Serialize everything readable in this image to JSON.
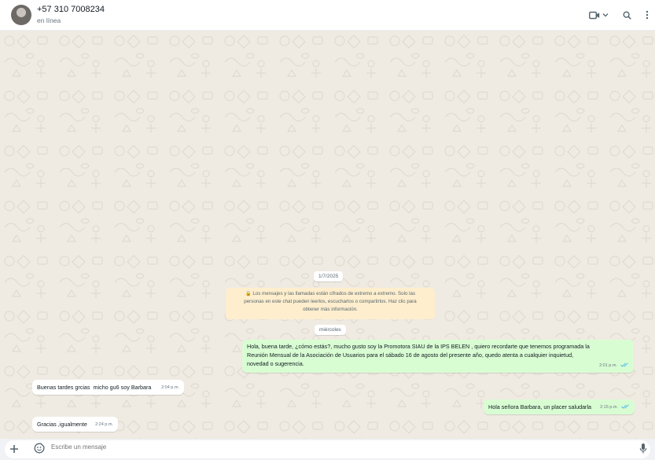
{
  "header": {
    "contact_name": "+57 310 7008234",
    "status": "en línea",
    "icons": [
      "video-call-icon",
      "chevron-down-icon",
      "search-icon",
      "menu-kebab-icon"
    ]
  },
  "chat": {
    "date_pill": "1/7/2025",
    "encryption_notice_lines": [
      "🔒 Los mensajes y las llamadas están cifrados de extremo a extremo. Solo las",
      "personas en este chat pueden leerlos, escucharlos o compartirlos. Haz clic para",
      "obtener más información."
    ],
    "day_pill": "miércoles",
    "messages": [
      {
        "direction": "out",
        "lines": [
          "Hola, buena tarde, ¿cómo estás?, mucho gusto soy la Promotora SIAU de la IPS BELEN , quiero recordarte que tenemos programada la",
          "Reunión Mensual de la Asociación de Usuarios para el sábado 16 de agosto del presente año, quedo atenta a cualquier inquietud,",
          "novedad o sugerencia."
        ],
        "time": "2:01 p.m.",
        "status": "read"
      },
      {
        "direction": "in",
        "text": "Buenas tardes grcias  micho gu6 soy Barbara",
        "time": "2:04 p.m."
      },
      {
        "direction": "out",
        "text": "Hola señora Barbara, un placer saludarla",
        "time": "2:15 p.m.",
        "status": "read"
      },
      {
        "direction": "in",
        "text": "Gracias ,igualmente",
        "time": "2:24 p.m."
      }
    ]
  },
  "composer": {
    "placeholder": "Escribe un mensaje",
    "icons": [
      "plus-icon",
      "sticker-icon",
      "microphone-icon"
    ]
  },
  "colors": {
    "chat_bg": "#efeae2",
    "outgoing_bubble": "#d9fdd3",
    "incoming_bubble": "#ffffff",
    "encryption_bg": "#ffeecd",
    "read_ticks": "#53bdeb"
  }
}
